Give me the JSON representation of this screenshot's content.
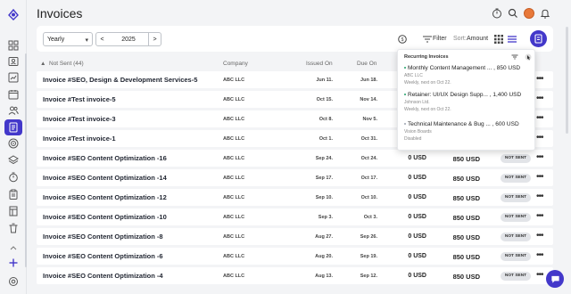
{
  "app": {
    "title": "Invoices"
  },
  "sidebar": {
    "items": [
      {
        "icon": "logo-icon"
      },
      {
        "icon": "grid-icon"
      },
      {
        "icon": "contact-card-icon"
      },
      {
        "icon": "chart-icon"
      },
      {
        "icon": "calendar-icon"
      },
      {
        "icon": "users-icon"
      },
      {
        "icon": "invoice-icon",
        "active": true
      },
      {
        "icon": "target-icon"
      },
      {
        "icon": "layers-icon"
      },
      {
        "icon": "timer-icon"
      },
      {
        "icon": "clipboard-icon"
      },
      {
        "icon": "ledger-icon"
      },
      {
        "icon": "trash-icon"
      },
      {
        "icon": "plus-icon"
      },
      {
        "icon": "settings-icon"
      }
    ],
    "active_color": "#4338ca"
  },
  "header": {
    "icons": [
      "timer-icon",
      "search-icon",
      "avatar",
      "bell-icon"
    ]
  },
  "toolbar": {
    "period_value": "Yearly",
    "year": "2025",
    "prev_label": "<",
    "next_label": ">",
    "filter_label": "Filter",
    "sort_prefix": "Sort:",
    "sort_value": "Amount"
  },
  "table": {
    "group_label": "Not Sent (44)",
    "columns": {
      "company": "Company",
      "issued": "Issued On",
      "due": "Due On"
    },
    "rows": [
      {
        "title": "Invoice #SEO, Design & Development Services-5",
        "company": "ABC LLC",
        "issued": "Jun 11.",
        "due": "Jun 18.",
        "paid": "",
        "amount": "",
        "status": ""
      },
      {
        "title": "Invoice #Test invoice-5",
        "company": "ABC LLC",
        "issued": "Oct 15.",
        "due": "Nov 14.",
        "paid": "",
        "amount": "",
        "status": ""
      },
      {
        "title": "Invoice #Test invoice-3",
        "company": "ABC LLC",
        "issued": "Oct 8.",
        "due": "Nov 5.",
        "paid": "",
        "amount": "",
        "status": ""
      },
      {
        "title": "Invoice #Test invoice-1",
        "company": "ABC LLC",
        "issued": "Oct 1.",
        "due": "Oct 31.",
        "paid": "",
        "amount": "",
        "status": ""
      },
      {
        "title": "Invoice #SEO Content Optimization -16",
        "company": "ABC LLC",
        "issued": "Sep 24.",
        "due": "Oct 24.",
        "paid": "0 USD",
        "amount": "850 USD",
        "status": "NOT SENT"
      },
      {
        "title": "Invoice #SEO Content Optimization -14",
        "company": "ABC LLC",
        "issued": "Sep 17.",
        "due": "Oct 17.",
        "paid": "0 USD",
        "amount": "850 USD",
        "status": "NOT SENT"
      },
      {
        "title": "Invoice #SEO Content Optimization -12",
        "company": "ABC LLC",
        "issued": "Sep 10.",
        "due": "Oct 10.",
        "paid": "0 USD",
        "amount": "850 USD",
        "status": "NOT SENT"
      },
      {
        "title": "Invoice #SEO Content Optimization -10",
        "company": "ABC LLC",
        "issued": "Sep 3.",
        "due": "Oct 3.",
        "paid": "0 USD",
        "amount": "850 USD",
        "status": "NOT SENT"
      },
      {
        "title": "Invoice #SEO Content Optimization -8",
        "company": "ABC LLC",
        "issued": "Aug 27.",
        "due": "Sep 26.",
        "paid": "0 USD",
        "amount": "850 USD",
        "status": "NOT SENT"
      },
      {
        "title": "Invoice #SEO Content Optimization -6",
        "company": "ABC LLC",
        "issued": "Aug 20.",
        "due": "Sep 19.",
        "paid": "0 USD",
        "amount": "850 USD",
        "status": "NOT SENT"
      },
      {
        "title": "Invoice #SEO Content Optimization -4",
        "company": "ABC LLC",
        "issued": "Aug 13.",
        "due": "Sep 12.",
        "paid": "0 USD",
        "amount": "850 USD",
        "status": "NOT SENT"
      }
    ]
  },
  "recurring": {
    "title": "Recurring Invoices",
    "items": [
      {
        "name": "Monthly Content Management ... , 850 USD",
        "client": "ABC LLC",
        "schedule": "Weekly, next on Oct 22.",
        "color": "#22a06b"
      },
      {
        "name": "Retainer: UI/UX Design Supp... , 1,400 USD",
        "client": "Johnson Ltd.",
        "schedule": "Weekly, next on Oct 22.",
        "color": "#22a06b"
      },
      {
        "name": "Technical Maintenance & Bug ... , 600 USD",
        "client": "Vision Boards",
        "schedule": "Disabled",
        "color": "#9ca3af"
      }
    ]
  }
}
